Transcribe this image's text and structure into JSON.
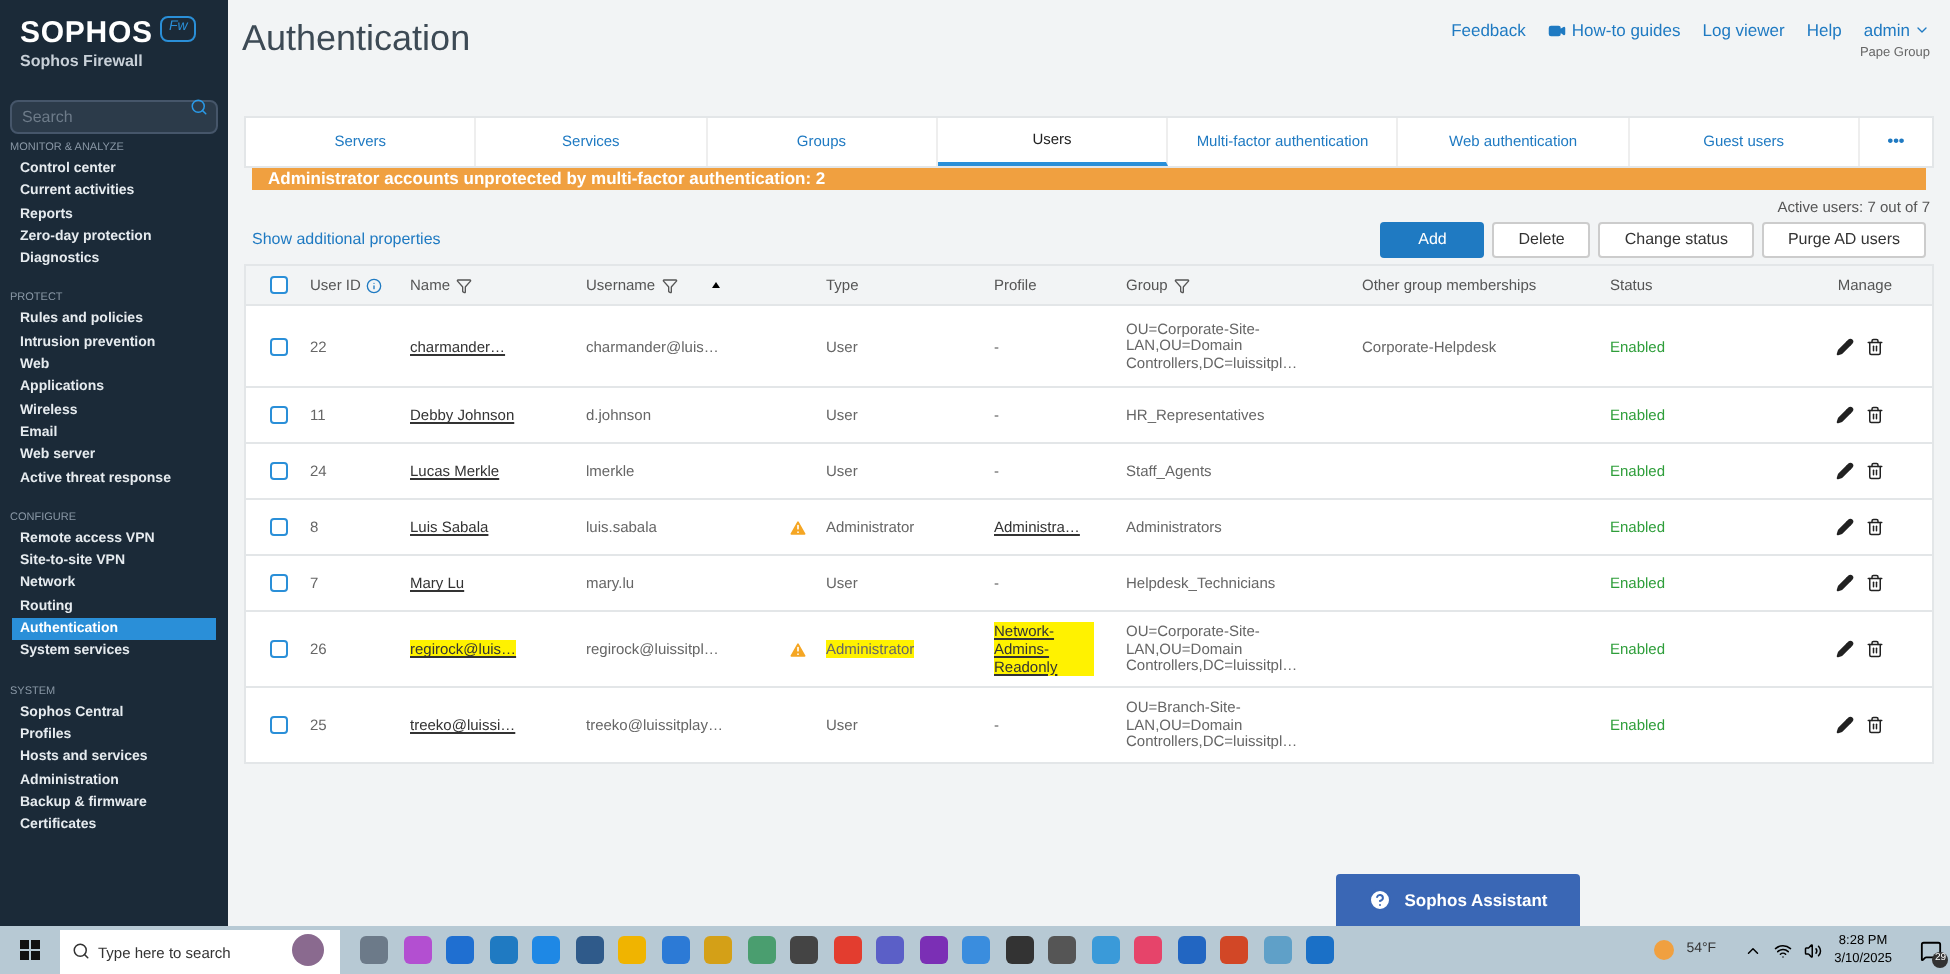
{
  "brand": {
    "name": "SOPHOS",
    "badge": "Fw",
    "product": "Sophos Firewall"
  },
  "sidebar": {
    "search": {
      "placeholder": "Search"
    },
    "sections": [
      {
        "title": "MONITOR & ANALYZE",
        "items": [
          {
            "label": "Control center",
            "selected": false
          },
          {
            "label": "Current activities",
            "selected": false
          },
          {
            "label": "Reports",
            "selected": false
          },
          {
            "label": "Zero-day protection",
            "selected": false
          },
          {
            "label": "Diagnostics",
            "selected": false
          }
        ]
      },
      {
        "title": "PROTECT",
        "items": [
          {
            "label": "Rules and policies",
            "selected": false
          },
          {
            "label": "Intrusion prevention",
            "selected": false
          },
          {
            "label": "Web",
            "selected": false
          },
          {
            "label": "Applications",
            "selected": false
          },
          {
            "label": "Wireless",
            "selected": false
          },
          {
            "label": "Email",
            "selected": false
          },
          {
            "label": "Web server",
            "selected": false
          },
          {
            "label": "Active threat response",
            "selected": false
          }
        ]
      },
      {
        "title": "CONFIGURE",
        "items": [
          {
            "label": "Remote access VPN",
            "selected": false
          },
          {
            "label": "Site-to-site VPN",
            "selected": false
          },
          {
            "label": "Network",
            "selected": false
          },
          {
            "label": "Routing",
            "selected": false
          },
          {
            "label": "Authentication",
            "selected": true
          },
          {
            "label": "System services",
            "selected": false
          }
        ]
      },
      {
        "title": "SYSTEM",
        "items": [
          {
            "label": "Sophos Central",
            "selected": false
          },
          {
            "label": "Profiles",
            "selected": false
          },
          {
            "label": "Hosts and services",
            "selected": false
          },
          {
            "label": "Administration",
            "selected": false
          },
          {
            "label": "Backup & firmware",
            "selected": false
          },
          {
            "label": "Certificates",
            "selected": false
          }
        ]
      }
    ]
  },
  "page": {
    "title": "Authentication",
    "links": [
      {
        "label": "Feedback",
        "kind": "text"
      },
      {
        "label": "How-to guides",
        "kind": "video"
      },
      {
        "label": "Log viewer",
        "kind": "text"
      },
      {
        "label": "Help",
        "kind": "text"
      },
      {
        "label": "admin",
        "kind": "menu"
      }
    ],
    "organization": "Pape Group"
  },
  "tabs": [
    {
      "label": "Servers",
      "selected": false
    },
    {
      "label": "Services",
      "selected": false
    },
    {
      "label": "Groups",
      "selected": false
    },
    {
      "label": "Users",
      "selected": true
    },
    {
      "label": "Multi-factor authentication",
      "selected": false
    },
    {
      "label": "Web authentication",
      "selected": false
    },
    {
      "label": "Guest users",
      "selected": false
    }
  ],
  "tabs_more": "•••",
  "banner": "Administrator accounts unprotected by multi-factor authentication: 2",
  "active_users": "Active users: 7 out of 7",
  "show_properties": "Show additional properties",
  "buttons": [
    {
      "label": "Add",
      "kind": "primary"
    },
    {
      "label": "Delete",
      "kind": "secondary"
    },
    {
      "label": "Change status",
      "kind": "secondary"
    },
    {
      "label": "Purge AD users",
      "kind": "secondary"
    }
  ],
  "table": {
    "select_all": {
      "checked": false
    },
    "columns": [
      "User ID",
      "Name",
      "Username",
      "Type",
      "Profile",
      "Group",
      "Other group memberships",
      "Status",
      "Manage"
    ],
    "rows": [
      {
        "checked": false,
        "id": "22",
        "name": "charmander…",
        "name_highlighted": false,
        "username": "charmander@luis…",
        "warning": false,
        "type": "User",
        "type_highlighted": false,
        "profile": "-",
        "profile_highlighted": false,
        "group": "OU=Corporate-Site-LAN,OU=Domain Controllers,DC=luissitpl…",
        "other": "Corporate-Helpdesk",
        "status": "Enabled"
      },
      {
        "checked": false,
        "id": "11",
        "name": "Debby Johnson",
        "name_highlighted": false,
        "username": "d.johnson",
        "warning": false,
        "type": "User",
        "type_highlighted": false,
        "profile": "-",
        "profile_highlighted": false,
        "group": "HR_Representatives",
        "other": "",
        "status": "Enabled"
      },
      {
        "checked": false,
        "id": "24",
        "name": "Lucas Merkle",
        "name_highlighted": false,
        "username": "lmerkle",
        "warning": false,
        "type": "User",
        "type_highlighted": false,
        "profile": "-",
        "profile_highlighted": false,
        "group": "Staff_Agents",
        "other": "",
        "status": "Enabled"
      },
      {
        "checked": false,
        "id": "8",
        "name": "Luis Sabala",
        "name_highlighted": false,
        "username": "luis.sabala",
        "warning": true,
        "type": "Administrator",
        "type_highlighted": false,
        "profile": "Administra…",
        "profile_highlighted": false,
        "group": "Administrators",
        "other": "",
        "status": "Enabled"
      },
      {
        "checked": false,
        "id": "7",
        "name": "Mary Lu",
        "name_highlighted": false,
        "username": "mary.lu",
        "warning": false,
        "type": "User",
        "type_highlighted": false,
        "profile": "-",
        "profile_highlighted": false,
        "group": "Helpdesk_Technicians",
        "other": "",
        "status": "Enabled"
      },
      {
        "checked": false,
        "id": "26",
        "name": "regirock@luis…",
        "name_highlighted": true,
        "username": "regirock@luissitpl…",
        "warning": true,
        "type": "Administrator",
        "type_highlighted": true,
        "profile": "Network-Admins-Readonly",
        "profile_highlighted": true,
        "group": "OU=Corporate-Site-LAN,OU=Domain Controllers,DC=luissitpl…",
        "other": "",
        "status": "Enabled"
      },
      {
        "checked": false,
        "id": "25",
        "name": "treeko@luissi…",
        "name_highlighted": false,
        "username": "treeko@luissitplay…",
        "warning": false,
        "type": "User",
        "type_highlighted": false,
        "profile": "-",
        "profile_highlighted": false,
        "group": "OU=Branch-Site-LAN,OU=Domain Controllers,DC=luissitpl…",
        "other": "",
        "status": "Enabled"
      }
    ]
  },
  "assistant": "Sophos Assistant",
  "taskbar": {
    "search": {
      "placeholder": "Type here to search"
    },
    "weather": "54°F",
    "time": "8:28 PM",
    "date": "3/10/2025",
    "notifications": "29"
  }
}
